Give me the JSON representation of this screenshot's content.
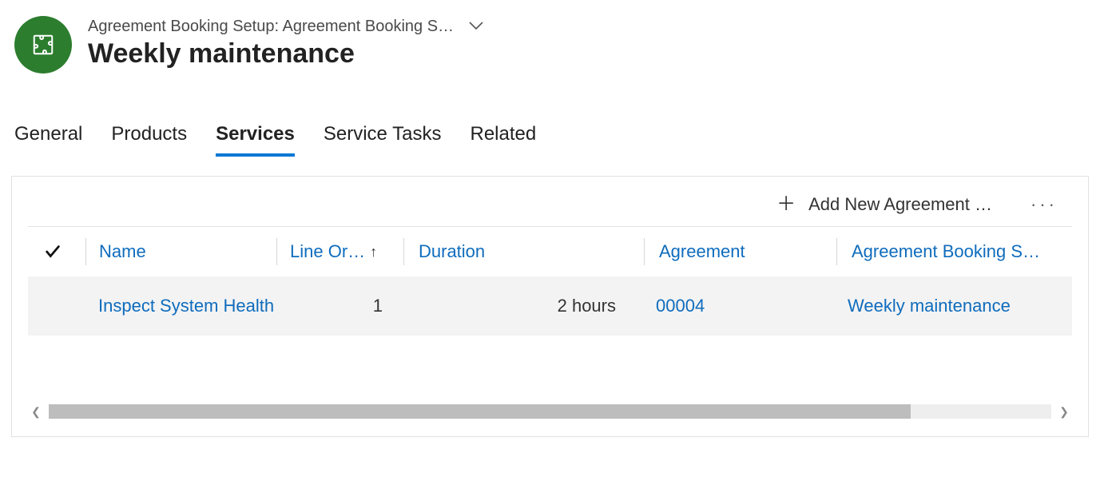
{
  "header": {
    "breadcrumb": "Agreement Booking Setup: Agreement Booking S…",
    "title": "Weekly maintenance"
  },
  "tabs": {
    "general": "General",
    "products": "Products",
    "services": "Services",
    "service_tasks": "Service Tasks",
    "related": "Related",
    "active": "services"
  },
  "toolbar": {
    "add_label": "Add New Agreement …",
    "more_label": "···"
  },
  "columns": {
    "name": "Name",
    "line_order": "Line Or…",
    "duration": "Duration",
    "agreement": "Agreement",
    "booking_setup": "Agreement Booking S…"
  },
  "rows": [
    {
      "name": "Inspect System Health",
      "line_order": "1",
      "duration": "2 hours",
      "agreement": "00004",
      "booking_setup": "Weekly maintenance"
    }
  ]
}
